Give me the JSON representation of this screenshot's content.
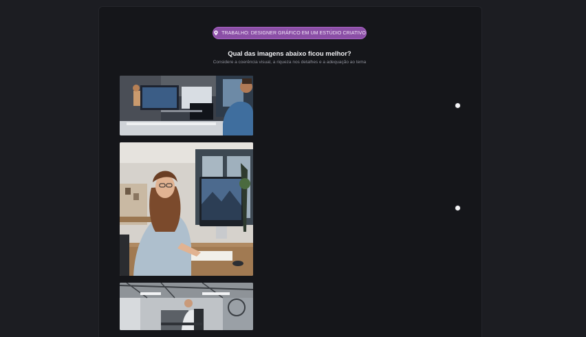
{
  "tag": {
    "label": "TRABALHO: DESIGNER GRÁFICO EM UM ESTÚDIO CRIATIVO",
    "icon": "location-pin-icon",
    "color": "#8b4fa6"
  },
  "question": {
    "title": "Qual das imagens abaixo ficou melhor?",
    "subtitle": "Considere a coerência visual, a riqueza nos detalhes e a adequação ao tema"
  },
  "options": [
    {
      "image": "office-designers-at-monitors-photo",
      "selected": false
    },
    {
      "image": "woman-designer-at-imac-photo",
      "selected": false
    },
    {
      "image": "industrial-studio-worker-photo",
      "selected": false
    }
  ]
}
